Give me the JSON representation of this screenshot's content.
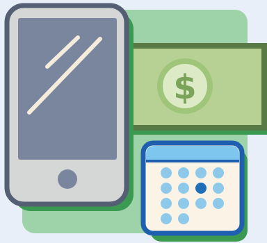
{
  "illustration": {
    "subject": "mobile-payment-schedule",
    "colors": {
      "background": "#e8eff8",
      "green_panel": "#9ed3aa",
      "drop_shadow_green": "#3b9a52",
      "phone_frame": "#d5d7d6",
      "phone_outline": "#555f73",
      "phone_screen": "#7a859e",
      "screen_glare": "#f5ecdc",
      "home_button": "#7a859e",
      "bill_fill": "#b7d093",
      "bill_border": "#5a7a45",
      "bill_coin": "#dcebc5",
      "dollar_color": "#7ca35a",
      "calendar_paper": "#fbf3e6",
      "calendar_header": "#7fc6ee",
      "calendar_outline": "#1f5fb0",
      "calendar_dot": "#8fc9ea",
      "calendar_dot_selected": "#1f6fb8"
    },
    "icons": [
      "smartphone-icon",
      "dollar-bill-icon",
      "calendar-icon"
    ],
    "bill_symbol": "$",
    "calendar": {
      "rows": [
        4,
        4,
        4,
        2
      ],
      "selected_row": 2,
      "selected_col": 3
    }
  }
}
